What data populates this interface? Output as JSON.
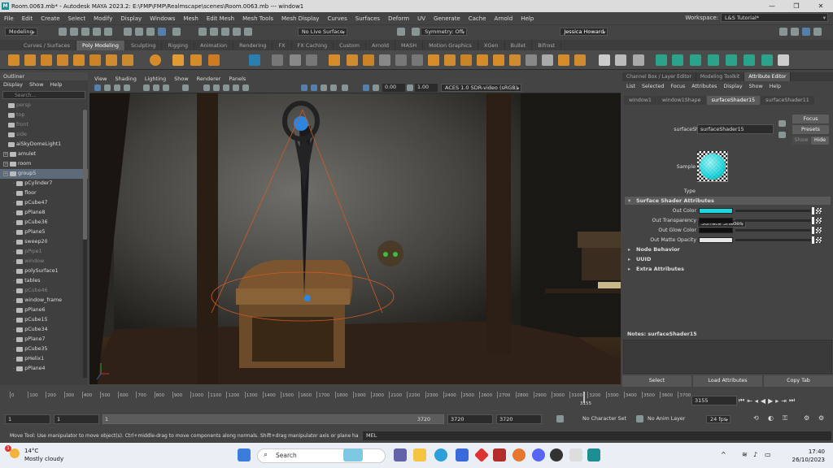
{
  "window": {
    "title": "Room.0063.mb* - Autodesk MAYA 2023.2: E:\\FMP\\FMP\\Realmscape\\scenes\\Room.0063.mb  ---  window1",
    "minimize": "—",
    "maximize": "❐",
    "close": "✕"
  },
  "menu": [
    "File",
    "Edit",
    "Create",
    "Select",
    "Modify",
    "Display",
    "Windows",
    "Mesh",
    "Edit Mesh",
    "Mesh Tools",
    "Mesh Display",
    "Curves",
    "Surfaces",
    "Deform",
    "UV",
    "Generate",
    "Cache",
    "Arnold",
    "Help"
  ],
  "workspace": {
    "label": "Workspace:",
    "value": "L&S Tutorial*"
  },
  "status": {
    "mode": "Modeling",
    "live_surface": "No Live Surface",
    "symmetry": "Symmetry: Off",
    "user": "Jessica Howard"
  },
  "shelf_tabs": [
    "Curves / Surfaces",
    "Poly Modeling",
    "Sculpting",
    "Rigging",
    "Animation",
    "Rendering",
    "FX",
    "FX Caching",
    "Custom",
    "Arnold",
    "MASH",
    "Motion Graphics",
    "XGen",
    "Bullet",
    "Bifrost"
  ],
  "shelf_active": "Poly Modeling",
  "outliner": {
    "title": "Outliner",
    "menu": [
      "Display",
      "Show",
      "Help"
    ],
    "search_placeholder": "Search...",
    "rows": [
      {
        "label": "persp",
        "dim": true,
        "indent": 1
      },
      {
        "label": "top",
        "dim": true,
        "indent": 1
      },
      {
        "label": "front",
        "dim": true,
        "indent": 1
      },
      {
        "label": "side",
        "dim": true,
        "indent": 1
      },
      {
        "label": "aiSkyDomeLight1",
        "dim": false,
        "indent": 1
      },
      {
        "label": "amulet",
        "dim": false,
        "indent": 0
      },
      {
        "label": "room",
        "dim": false,
        "indent": 0
      },
      {
        "label": "group5",
        "dim": false,
        "indent": 0,
        "selected": true
      },
      {
        "label": "pCylinder7",
        "dim": false,
        "indent": 2
      },
      {
        "label": "floor",
        "dim": false,
        "indent": 2
      },
      {
        "label": "pCube47",
        "dim": false,
        "indent": 2
      },
      {
        "label": "pPlane8",
        "dim": false,
        "indent": 2
      },
      {
        "label": "pCube36",
        "dim": false,
        "indent": 2
      },
      {
        "label": "pPlane5",
        "dim": false,
        "indent": 2
      },
      {
        "label": "sweep20",
        "dim": false,
        "indent": 2
      },
      {
        "label": "pPipe1",
        "dim": true,
        "indent": 2
      },
      {
        "label": "window",
        "dim": true,
        "indent": 2
      },
      {
        "label": "polySurface1",
        "dim": false,
        "indent": 2
      },
      {
        "label": "tables",
        "dim": false,
        "indent": 2
      },
      {
        "label": "pCube46",
        "dim": true,
        "indent": 2
      },
      {
        "label": "window_frame",
        "dim": false,
        "indent": 2
      },
      {
        "label": "pPlane6",
        "dim": false,
        "indent": 2
      },
      {
        "label": "pCube15",
        "dim": false,
        "indent": 2
      },
      {
        "label": "pCube34",
        "dim": false,
        "indent": 2
      },
      {
        "label": "pPlane7",
        "dim": false,
        "indent": 2
      },
      {
        "label": "pCube35",
        "dim": false,
        "indent": 2
      },
      {
        "label": "pHelix1",
        "dim": false,
        "indent": 2
      },
      {
        "label": "pPlane4",
        "dim": false,
        "indent": 2
      }
    ]
  },
  "viewport": {
    "menu": [
      "View",
      "Shading",
      "Lighting",
      "Show",
      "Renderer",
      "Panels"
    ],
    "exposure": "0.00",
    "gamma": "1.00",
    "colorspace": "ACES 1.0 SDR-video (sRGB)"
  },
  "attribute_editor": {
    "panel_tabs": [
      "Channel Box / Layer Editor",
      "Modeling Toolkit",
      "Attribute Editor"
    ],
    "active_panel_tab": "Attribute Editor",
    "menu": [
      "List",
      "Selected",
      "Focus",
      "Attributes",
      "Display",
      "Show",
      "Help"
    ],
    "node_tabs": [
      "window1",
      "window1Shape",
      "surfaceShader15",
      "surfaceShader11"
    ],
    "active_node_tab": "surfaceShader15",
    "node_label": "surfaceShader:",
    "node_name": "surfaceShader15",
    "focus": "Focus",
    "presets": "Presets",
    "show": "Show",
    "hide": "Hide",
    "sample_label": "Sample",
    "type_label": "Type",
    "type_value": "Surface Shader",
    "section_open": "Surface Shader Attributes",
    "attrs": [
      {
        "label": "Out Color",
        "color": "#19d8e0"
      },
      {
        "label": "Out Transparency",
        "color": "#101010"
      },
      {
        "label": "Out Glow Color",
        "color": "#101010"
      },
      {
        "label": "Out Matte Opacity",
        "color": "#e6e6e6"
      }
    ],
    "sections_closed": [
      "Node Behavior",
      "UUID",
      "Extra Attributes"
    ],
    "notes_label": "Notes:  surfaceShader15",
    "bottom_buttons": [
      "Select",
      "Load Attributes",
      "Copy Tab"
    ]
  },
  "timeline": {
    "ticks": [
      "0",
      "100",
      "200",
      "300",
      "400",
      "500",
      "600",
      "700",
      "800",
      "900",
      "1000",
      "1100",
      "1200",
      "1300",
      "1400",
      "1500",
      "1600",
      "1700",
      "1800",
      "1900",
      "2000",
      "2100",
      "2200",
      "2300",
      "2400",
      "2500",
      "2600",
      "2700",
      "2800",
      "2900",
      "3000",
      "3100",
      "3200",
      "3300",
      "3400",
      "3500",
      "3600",
      "3700"
    ],
    "current_frame_label": "3155",
    "current_frame": "3155"
  },
  "range": {
    "start": "1",
    "start2": "1",
    "slider_start": "1",
    "slider_end": "3720",
    "end": "3720",
    "end2": "3720",
    "character_set": "No Character Set",
    "anim_layer": "No Anim Layer",
    "fps": "24 fps"
  },
  "help_line": "Move Tool: Use manipulator to move object(s). Ctrl+middle-drag to move components along normals. Shift+drag manipulator axis or plane handles to ext",
  "mel_label": "MEL",
  "taskbar": {
    "temp": "14°C",
    "weather": "Mostly cloudy",
    "search": "Search",
    "time": "17:40",
    "date": "26/10/2023",
    "badge": "1"
  },
  "colors": {
    "accent": "#19d8e0",
    "selection": "#5c6a7a"
  }
}
